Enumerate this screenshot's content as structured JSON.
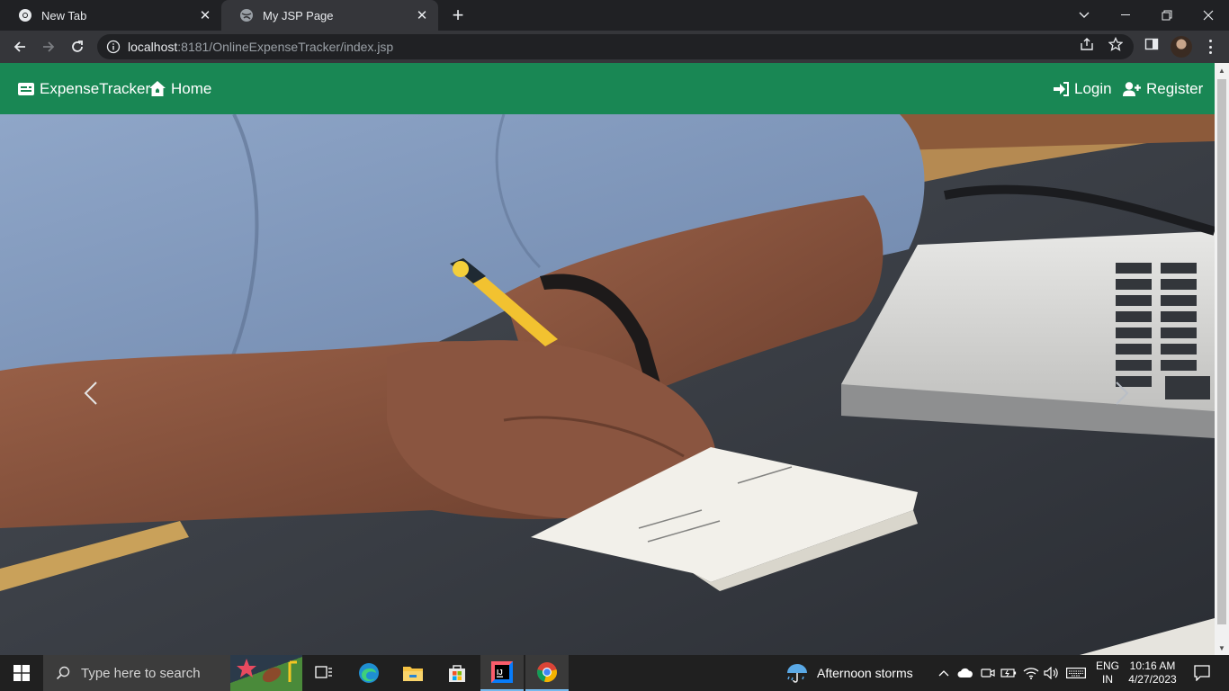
{
  "browser": {
    "tabs": [
      {
        "title": "New Tab",
        "active": false
      },
      {
        "title": "My JSP Page",
        "active": true
      }
    ],
    "url_host": "localhost",
    "url_rest": ":8181/OnlineExpenseTracker/index.jsp"
  },
  "navbar": {
    "background": "#198754",
    "brand": "ExpenseTracker",
    "home": "Home",
    "login": "Login",
    "register": "Register"
  },
  "hero": {
    "image_description": "Person writing with a yellow pen next to a laptop",
    "prev_icon": "chevron-left-icon",
    "next_icon": "chevron-right-icon"
  },
  "taskbar": {
    "search_placeholder": "Type here to search",
    "weather": "Afternoon storms",
    "lang_line1": "ENG",
    "lang_line2": "IN",
    "time": "10:16 AM",
    "date": "4/27/2023"
  }
}
